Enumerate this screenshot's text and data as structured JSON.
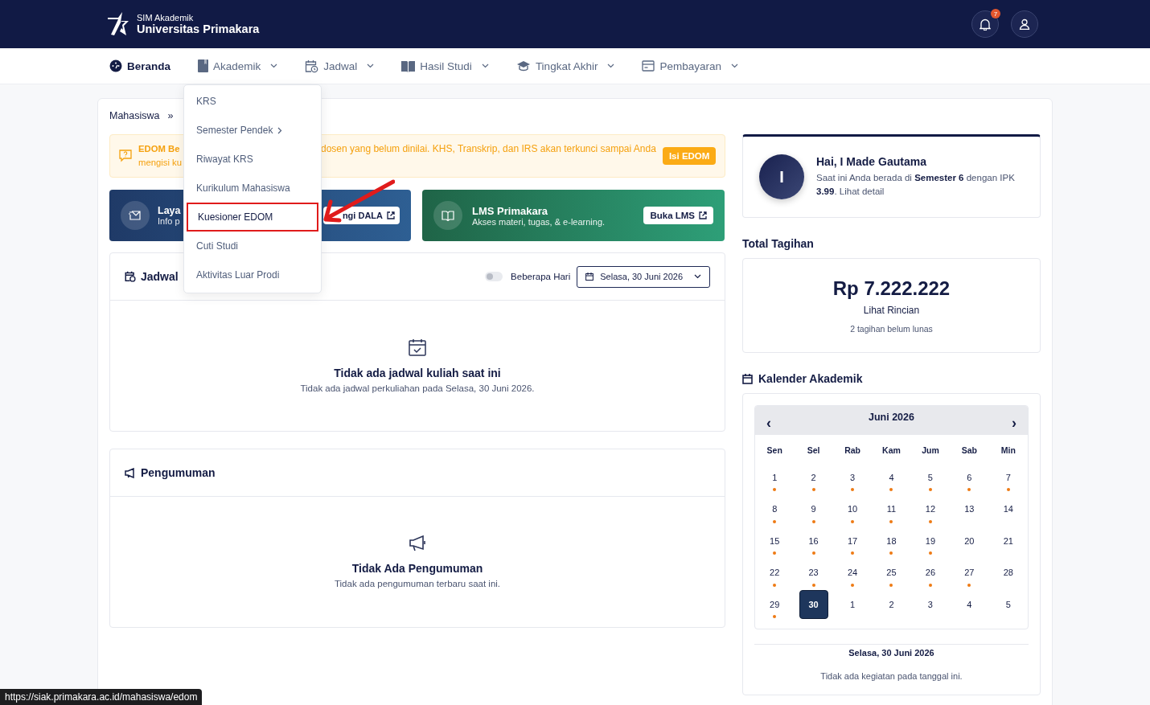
{
  "header": {
    "subtitle": "SIM Akademik",
    "title": "Universitas Primakara",
    "notification_count": "7"
  },
  "nav": [
    {
      "label": "Beranda",
      "selected": true,
      "dropdown": false
    },
    {
      "label": "Akademik",
      "selected": false,
      "dropdown": true
    },
    {
      "label": "Jadwal",
      "selected": false,
      "dropdown": true
    },
    {
      "label": "Hasil Studi",
      "selected": false,
      "dropdown": true
    },
    {
      "label": "Tingkat Akhir",
      "selected": false,
      "dropdown": true
    },
    {
      "label": "Pembayaran",
      "selected": false,
      "dropdown": true
    }
  ],
  "dropdown_menu": [
    {
      "label": "KRS",
      "submenu": false,
      "highlighted": false
    },
    {
      "label": "Semester Pendek",
      "submenu": true,
      "highlighted": false
    },
    {
      "label": "Riwayat KRS",
      "submenu": false,
      "highlighted": false
    },
    {
      "label": "Kurikulum Mahasiswa",
      "submenu": false,
      "highlighted": false
    },
    {
      "label": "Kuesioner EDOM",
      "submenu": false,
      "highlighted": true
    },
    {
      "label": "Cuti Studi",
      "submenu": false,
      "highlighted": false
    },
    {
      "label": "Aktivitas Luar Prodi",
      "submenu": false,
      "highlighted": false
    }
  ],
  "breadcrumb": [
    "Mahasiswa",
    "»"
  ],
  "alert": {
    "title_fragment": "EDOM Be",
    "line2_fragment": "mengisi ku",
    "text": "dosen yang belum dinilai. KHS, Transkrip, dan IRS akan terkunci sampai Anda",
    "button": "Isi EDOM"
  },
  "service_cards": [
    {
      "kind": "blue",
      "title": "Laya",
      "subtitle": "Info p",
      "button": "ngi DALA"
    },
    {
      "kind": "green",
      "title": "LMS Primakara",
      "subtitle": "Akses materi, tugas, & e-learning.",
      "button": "Buka LMS"
    }
  ],
  "schedule": {
    "title": "Jadwal",
    "toggle_label": "Beberapa Hari",
    "toggle_on": false,
    "date": "Selasa, 30 Juni 2026",
    "empty_title": "Tidak ada jadwal kuliah saat ini",
    "empty_text": "Tidak ada jadwal perkuliahan pada Selasa, 30 Juni 2026."
  },
  "announcements": {
    "title": "Pengumuman",
    "empty_title": "Tidak Ada Pengumuman",
    "empty_text": "Tidak ada pengumuman terbaru saat ini."
  },
  "profile": {
    "initial": "I",
    "greeting": "Hai, I Made Gautama",
    "text": "Saat ini Anda berada di **Semester 6** dengan IPK **3.99**. Lihat detail"
  },
  "bills": {
    "title": "Total Tagihan",
    "amount": "Rp 7.222.222",
    "link": "Lihat Rincian",
    "note": "2 tagihan belum lunas"
  },
  "calendar": {
    "title": "Kalender Akademik",
    "month": "Juni 2026",
    "prev": "‹",
    "next": "›",
    "weekdays": [
      "Sen",
      "Sel",
      "Rab",
      "Kam",
      "Jum",
      "Sab",
      "Min"
    ],
    "days": [
      {
        "label": "1",
        "event": true,
        "selected": false
      },
      {
        "label": "2",
        "event": true,
        "selected": false
      },
      {
        "label": "3",
        "event": true,
        "selected": false
      },
      {
        "label": "4",
        "event": true,
        "selected": false
      },
      {
        "label": "5",
        "event": true,
        "selected": false
      },
      {
        "label": "6",
        "event": true,
        "selected": false
      },
      {
        "label": "7",
        "event": true,
        "selected": false
      },
      {
        "label": "8",
        "event": true,
        "selected": false
      },
      {
        "label": "9",
        "event": true,
        "selected": false
      },
      {
        "label": "10",
        "event": true,
        "selected": false
      },
      {
        "label": "11",
        "event": true,
        "selected": false
      },
      {
        "label": "12",
        "event": true,
        "selected": false
      },
      {
        "label": "13",
        "event": false,
        "selected": false
      },
      {
        "label": "14",
        "event": false,
        "selected": false
      },
      {
        "label": "15",
        "event": true,
        "selected": false
      },
      {
        "label": "16",
        "event": true,
        "selected": false
      },
      {
        "label": "17",
        "event": true,
        "selected": false
      },
      {
        "label": "18",
        "event": true,
        "selected": false
      },
      {
        "label": "19",
        "event": true,
        "selected": false
      },
      {
        "label": "20",
        "event": false,
        "selected": false
      },
      {
        "label": "21",
        "event": false,
        "selected": false
      },
      {
        "label": "22",
        "event": true,
        "selected": false
      },
      {
        "label": "23",
        "event": true,
        "selected": false
      },
      {
        "label": "24",
        "event": true,
        "selected": false
      },
      {
        "label": "25",
        "event": true,
        "selected": false
      },
      {
        "label": "26",
        "event": true,
        "selected": false
      },
      {
        "label": "27",
        "event": true,
        "selected": false
      },
      {
        "label": "28",
        "event": false,
        "selected": false
      },
      {
        "label": "29",
        "event": true,
        "selected": false
      },
      {
        "label": "30",
        "event": false,
        "selected": true
      },
      {
        "label": "1",
        "event": false,
        "selected": false
      },
      {
        "label": "2",
        "event": false,
        "selected": false
      },
      {
        "label": "3",
        "event": false,
        "selected": false
      },
      {
        "label": "4",
        "event": false,
        "selected": false
      },
      {
        "label": "5",
        "event": false,
        "selected": false
      }
    ],
    "selected_date": "Selasa, 30 Juni 2026",
    "empty_text": "Tidak ada kegiatan pada tanggal ini."
  },
  "status_url": "https://siak.primakara.ac.id/mahasiswa/edom"
}
